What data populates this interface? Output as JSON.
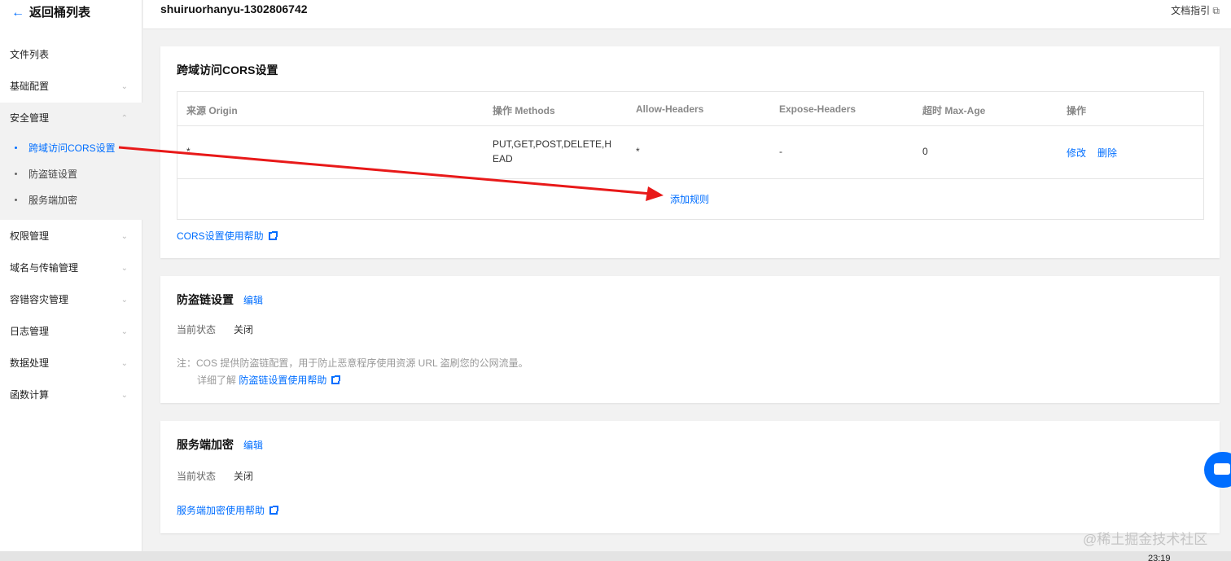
{
  "sidebar": {
    "back_label": "返回桶列表",
    "items": {
      "file_list": "文件列表",
      "basic_config": "基础配置",
      "security": "安全管理",
      "permissions": "权限管理",
      "domain_transfer": "域名与传输管理",
      "disaster": "容错容灾管理",
      "logs": "日志管理",
      "data_processing": "数据处理",
      "functions": "函数计算"
    },
    "sub_items": {
      "cors": "跨域访问CORS设置",
      "hotlink": "防盗链设置",
      "encryption": "服务端加密"
    }
  },
  "header": {
    "bucket_name": "shuiruorhanyu-1302806742",
    "doc_link": "文档指引"
  },
  "cors": {
    "title": "跨域访问CORS设置",
    "columns": {
      "origin": "来源 Origin",
      "methods": "操作 Methods",
      "allow_headers": "Allow-Headers",
      "expose_headers": "Expose-Headers",
      "max_age": "超时 Max-Age",
      "actions": "操作"
    },
    "row": {
      "origin": "*",
      "methods_line1": "PUT,GET,POST,DELETE,H",
      "methods_line2": "EAD",
      "allow_headers": "*",
      "expose_headers": "-",
      "max_age": "0",
      "edit": "修改",
      "delete": "删除"
    },
    "add_rule": "添加规则",
    "help": "CORS设置使用帮助"
  },
  "hotlink": {
    "title": "防盗链设置",
    "edit": "编辑",
    "status_label": "当前状态",
    "status_value": "关闭",
    "note": "注：COS 提供防盗链配置，用于防止恶意程序使用资源 URL 盗刷您的公网流量。",
    "note_more": "详细了解",
    "note_link": "防盗链设置使用帮助"
  },
  "encryption": {
    "title": "服务端加密",
    "edit": "编辑",
    "status_label": "当前状态",
    "status_value": "关闭",
    "help": "服务端加密使用帮助"
  },
  "watermark": "@稀土掘金技术社区",
  "clock": "23:19",
  "colors": {
    "accent": "#006eff",
    "annotation_arrow": "#e81919"
  }
}
